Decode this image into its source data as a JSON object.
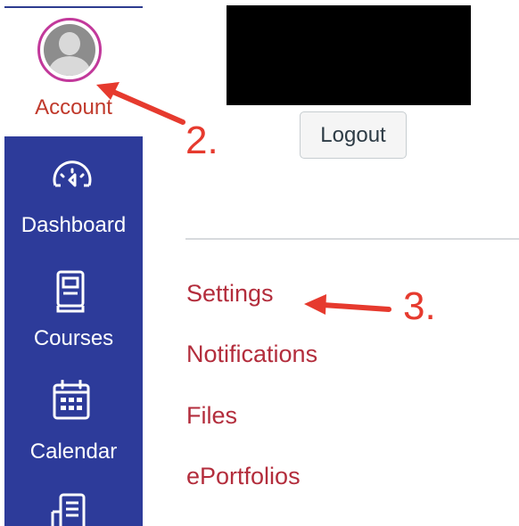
{
  "global_nav": {
    "account": {
      "label": "Account",
      "icon": "avatar-icon"
    },
    "items": [
      {
        "label": "Dashboard",
        "icon": "dashboard-icon"
      },
      {
        "label": "Courses",
        "icon": "courses-icon"
      },
      {
        "label": "Calendar",
        "icon": "calendar-icon"
      },
      {
        "label": "",
        "icon": "inbox-icon"
      }
    ],
    "colors": {
      "nav_bg": "#2d3b9a",
      "account_text": "#c0392b",
      "avatar_ring": "#c2399b"
    }
  },
  "account_tray": {
    "logout_label": "Logout",
    "links": [
      {
        "label": "Settings"
      },
      {
        "label": "Notifications"
      },
      {
        "label": "Files"
      },
      {
        "label": "ePortfolios"
      }
    ],
    "link_color": "#b32d3c"
  },
  "annotations": {
    "step2": "2.",
    "step3": "3.",
    "color": "#e63a2e"
  }
}
